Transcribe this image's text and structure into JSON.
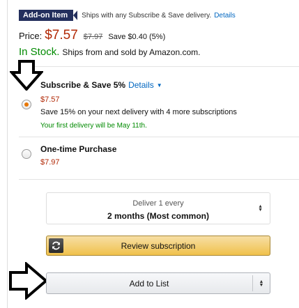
{
  "addon": {
    "badge": "Add-on Item",
    "text": "Ships with any Subscribe & Save delivery.",
    "details_link": "Details"
  },
  "price": {
    "label": "Price:",
    "value": "$7.57",
    "list_price": "$7.97",
    "savings": "Save $0.40 (5%)"
  },
  "stock": {
    "status": "In Stock.",
    "ships_from": "Ships from and sold by Amazon.com."
  },
  "subscribe": {
    "title": "Subscribe & Save 5%",
    "details_link": "Details",
    "price": "$7.57",
    "save_text": "Save 15% on your next delivery with 4 more subscriptions",
    "first_delivery": "Your first delivery will be May 11th.",
    "selected": true
  },
  "one_time": {
    "title": "One-time Purchase",
    "price": "$7.97",
    "selected": false
  },
  "deliver_every": {
    "label": "Deliver 1 every",
    "value": "2 months (Most common)"
  },
  "buttons": {
    "review": "Review subscription",
    "add_to_list": "Add to List"
  },
  "icons": {
    "down_arrow": "down-arrow-pointer-icon",
    "right_arrow": "right-arrow-pointer-icon",
    "refresh": "refresh-icon",
    "caret": "caret-down-icon"
  },
  "colors": {
    "price_red": "#b12704",
    "stock_green": "#008a00",
    "link_blue": "#0066c0",
    "radio_orange": "#e77600",
    "review_button": "#f0c14b",
    "badge_navy": "#232f5d"
  }
}
